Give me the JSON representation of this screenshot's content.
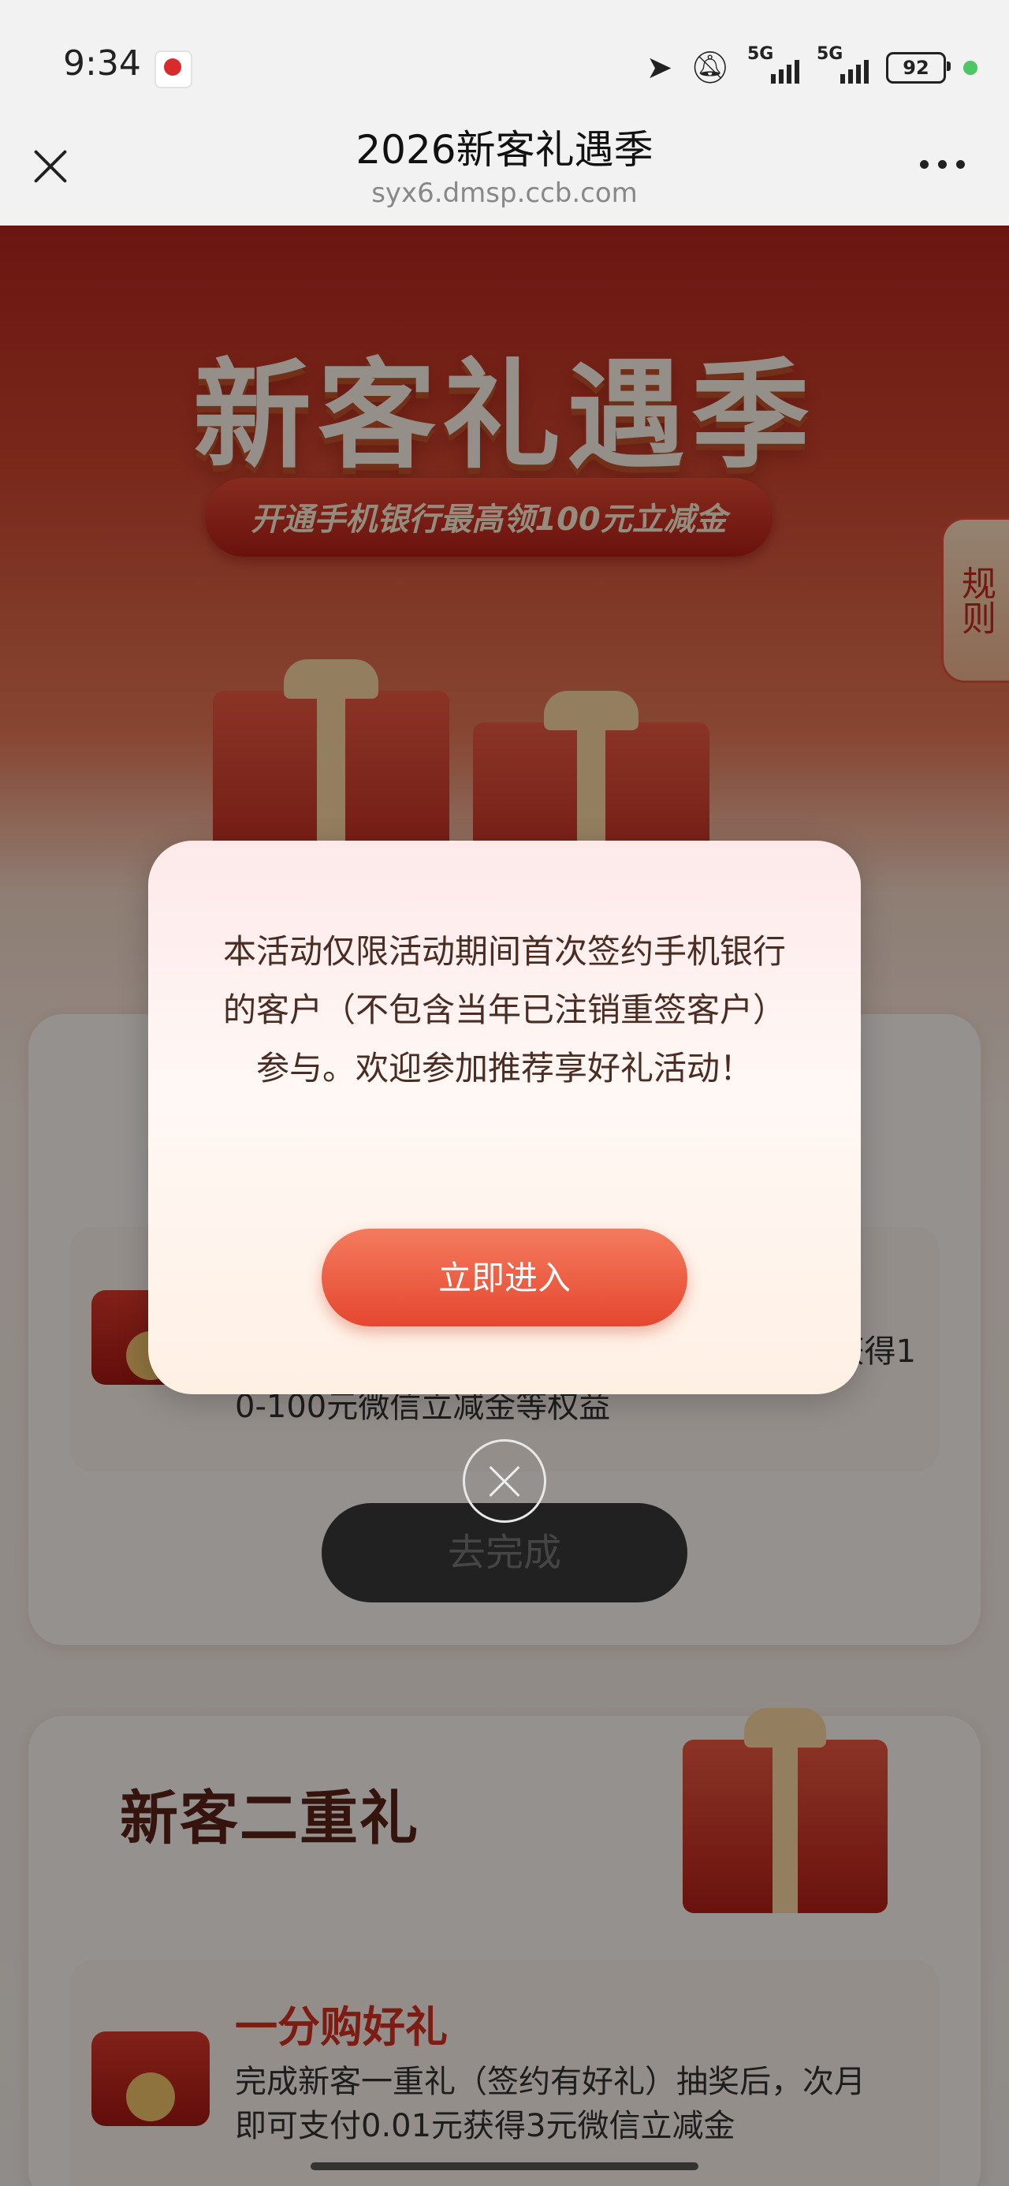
{
  "status_bar": {
    "time": "9:34",
    "network_1": "5G",
    "network_2": "5G",
    "battery": "92",
    "icons": [
      "location-arrow-icon",
      "bell-muted-icon",
      "signal-icon",
      "battery-icon"
    ]
  },
  "title_bar": {
    "title": "2026新客礼遇季",
    "url": "syx6.dmsp.ccb.com"
  },
  "hero": {
    "title": "新客礼遇季",
    "ribbon": "开通手机银行最高领100元立减金",
    "rules_tab": "规则"
  },
  "section1": {
    "desc_tail": "0-100元微信立减金等权益",
    "desc_right": "获得1",
    "button": "去完成"
  },
  "section2": {
    "title": "新客二重礼",
    "item_title": "一分购好礼",
    "item_desc": "完成新客一重礼（签约有好礼）抽奖后，次月即可支付0.01元获得3元微信立减金"
  },
  "modal": {
    "text": "本活动仅限活动期间首次签约手机银行的客户（不包含当年已注销重签客户）参与。欢迎参加推荐享好礼活动！",
    "button": "立即进入"
  },
  "colors": {
    "accent": "#e5472f",
    "brand_red": "#c72a1d"
  }
}
